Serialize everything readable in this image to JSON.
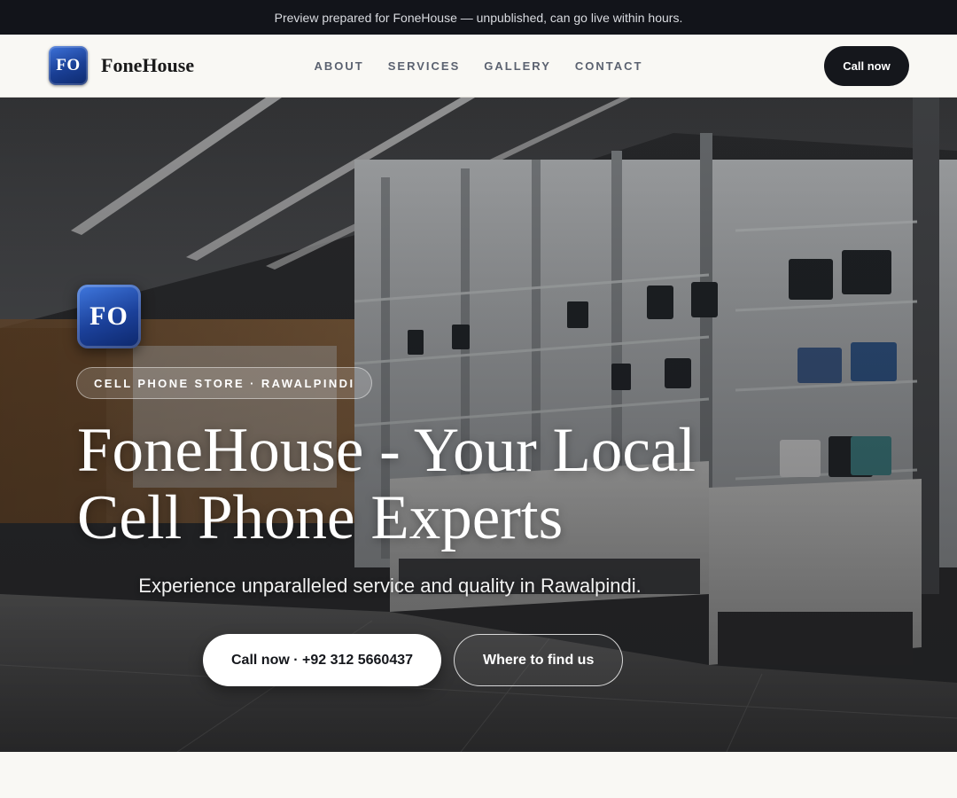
{
  "preview_banner": {
    "text": "Preview prepared for FoneHouse — unpublished, can go live within hours."
  },
  "header": {
    "logo_text": "FO",
    "brand_name": "FoneHouse",
    "nav": [
      {
        "label": "ABOUT"
      },
      {
        "label": "SERVICES"
      },
      {
        "label": "GALLERY"
      },
      {
        "label": "CONTACT"
      }
    ],
    "cta_label": "Call now"
  },
  "hero": {
    "logo_text": "FO",
    "kicker": "CELL PHONE STORE · RAWALPINDI",
    "title_line1": "FoneHouse - Your Local",
    "title_line2": "Cell Phone Experts",
    "subtitle": "Experience unparalleled service and quality in Rawalpindi.",
    "primary_button": "Call now · +92 312 5660437",
    "secondary_button": "Where to find us",
    "background_image": "phone-store-interior"
  },
  "colors": {
    "banner_bg": "#12141a",
    "page_bg": "#f9f8f4",
    "dark_button": "#15171c",
    "logo_blue": "#1a3f95",
    "nav_text": "#5b6270"
  }
}
